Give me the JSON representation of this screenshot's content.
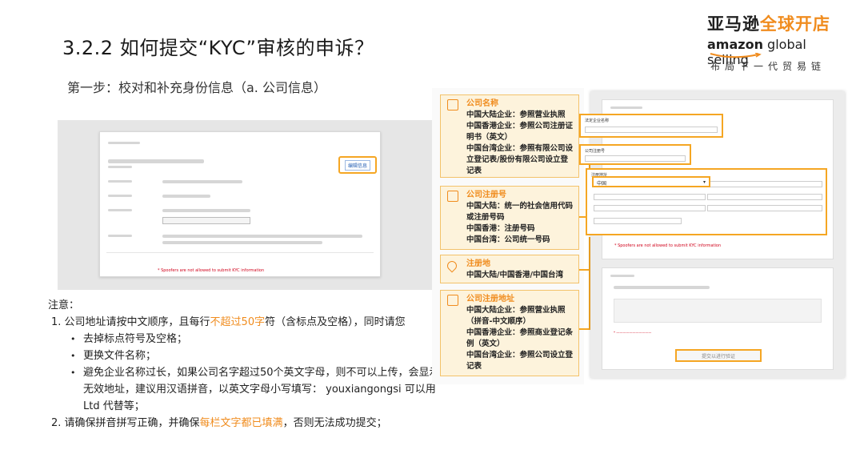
{
  "slide": {
    "title": "3.2.2 如何提交“KYC”审核的申诉？",
    "step_title": "第一步：校对和补充身份信息（a. 公司信息）"
  },
  "logo": {
    "cn_dark": "亚马逊",
    "cn_orange": "全球开店",
    "en_bold": "amazon",
    "en_rest": " global selling",
    "tagline": "布局下一代贸易链",
    "colors": {
      "orange": "#f08c1e",
      "dark": "#1f1f1f"
    }
  },
  "left_screenshot": {
    "edit_button": "编辑信息",
    "warning": "* Spoofers are not allowed to submit KYC information"
  },
  "notes": {
    "heading": "注意：",
    "item1_prefix": "1.  公司地址请按中文顺序，且每行",
    "item1_highlight": "不超过50字",
    "item1_suffix": "符（含标点及空格），同时请您",
    "bullets": [
      "去掉标点符号及空格；",
      "更换文件名称；",
      "避免企业名称过长，如果公司名字超过50个英文字母，则不可以上传，会显示无效地址，建议用汉语拼音，以英文字母小写填写：  youxiangongsi 可以用  Ltd  代替等；"
    ],
    "item2_prefix": "2.  请确保拼音拼写正确，并确保",
    "item2_highlight": "每栏文字都已填满",
    "item2_suffix": "，否则无法成功提交；"
  },
  "callouts": [
    {
      "title": "公司名称",
      "lines": [
        "中国大陆企业：参照营业执照",
        "中国香港企业：参照公司注册证明书（英文）",
        "中国台湾企业：参照有限公司设立登记表/股份有限公司设立登记表"
      ],
      "icon": "building-icon"
    },
    {
      "title": "公司注册号",
      "lines": [
        "中国大陆：统一的社会信用代码或注册号码",
        "中国香港：注册号码",
        "中国台湾：公司统一号码"
      ],
      "icon": "document-icon"
    },
    {
      "title": "注册地",
      "lines": [
        "中国大陆/中国香港/中国台湾"
      ],
      "icon": "location-pin-icon"
    },
    {
      "title": "公司注册地址",
      "lines": [
        "中国大陆企业：参照营业执照（拼音-中文顺序）",
        "中国香港企业：参照商业登记条例（英文）",
        "中国台湾企业：参照公司设立登记表"
      ],
      "icon": "address-card-icon"
    }
  ],
  "form_shot": {
    "company_name_label": "法定企业名称",
    "reg_number_label": "公司注册号",
    "address_label": "注册地址",
    "country_select": "中国",
    "warning": "* Spoofers are not allowed to submit KYC information",
    "submit_label": "提交以进行验证"
  }
}
